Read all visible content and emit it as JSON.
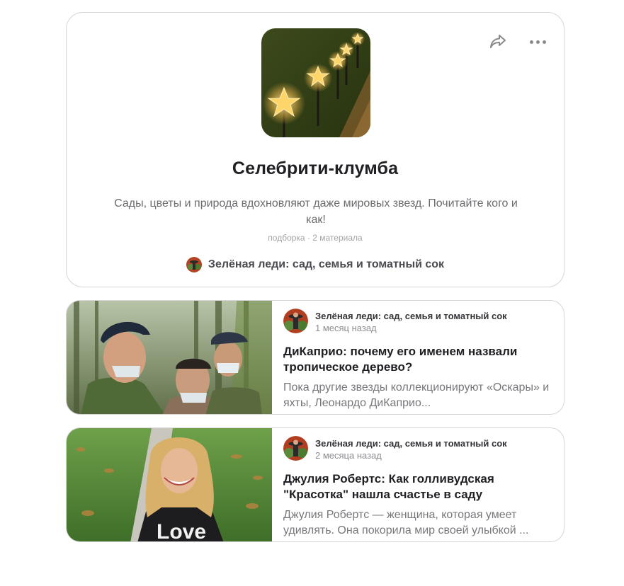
{
  "collection": {
    "title": "Селебрити-клумба",
    "description": "Сады, цветы и природа вдохновляют даже мировых звезд. Почитайте кого и как!",
    "meta": "подборка · 2 материала",
    "channel_name": "Зелёная леди: сад, семья и томатный сок",
    "cover_image": "garden-star-lights-photo",
    "actions": {
      "share_icon": "share-icon",
      "more_icon": "more-dots-icon"
    }
  },
  "articles": [
    {
      "author": "Зелёная леди: сад, семья и томатный сок",
      "time": "1 месяц назад",
      "title": "ДиКаприо: почему его именем назвали тропическое дерево?",
      "snippet": "Пока другие звезды коллекционируют «Оскары» и яхты, Леонардо ДиКаприо...",
      "thumbnail": "dicaprio-in-forest-photo"
    },
    {
      "author": "Зелёная леди: сад, семья и томатный сок",
      "time": "2 месяца назад",
      "title": "Джулия Робертс: Как голливудская \"Красотка\" нашла счастье в саду",
      "snippet": "Джулия Робертс — женщина, которая умеет удивлять. Она покорила мир своей улыбкой ...",
      "thumbnail": "julia-roberts-garden-photo",
      "thumbnail_text": "Love"
    }
  ],
  "colors": {
    "border": "#d6d6d9",
    "title": "#1f1f24",
    "muted": "#8d8d92"
  }
}
